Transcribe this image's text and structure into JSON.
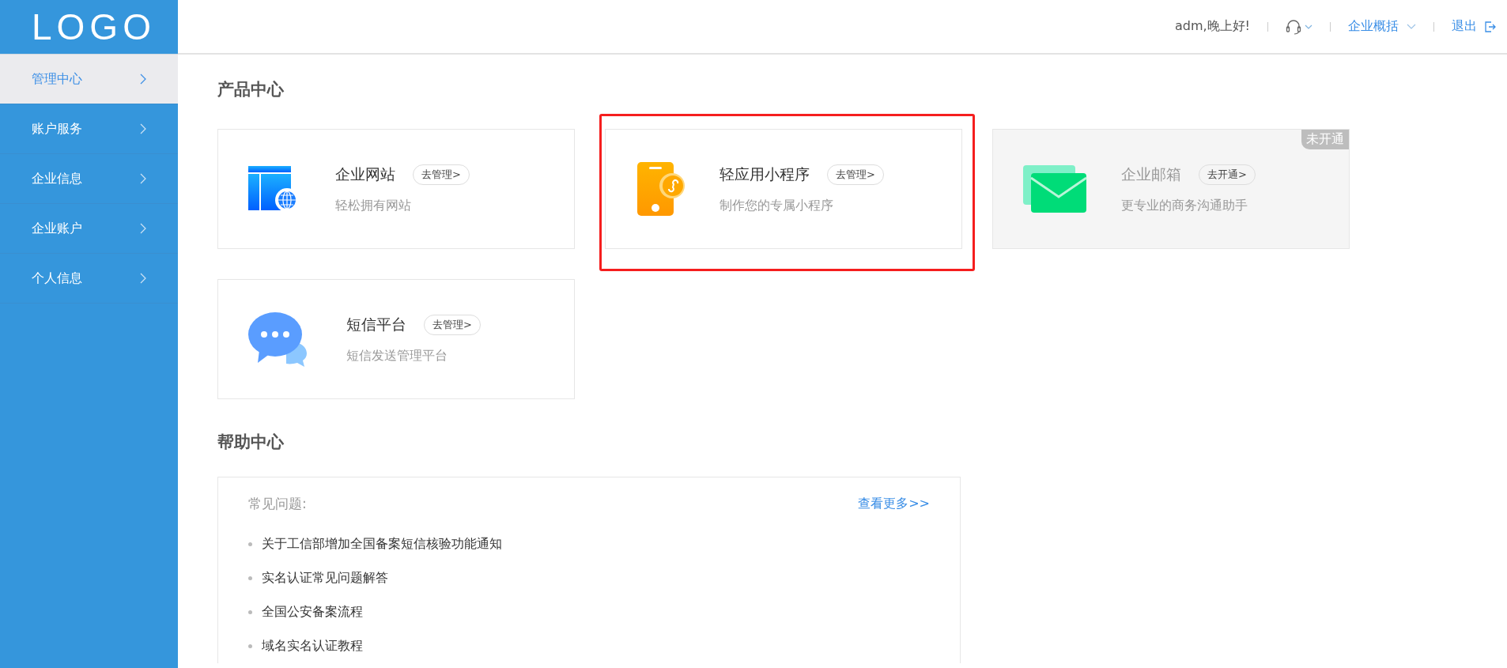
{
  "logo": "LOGO",
  "header": {
    "greeting": "adm,晚上好!",
    "menu_label": "企业概括",
    "logout": "退出"
  },
  "sidebar": {
    "items": [
      {
        "label": "管理中心",
        "selected": true
      },
      {
        "label": "账户服务",
        "selected": false
      },
      {
        "label": "企业信息",
        "selected": false
      },
      {
        "label": "企业账户",
        "selected": false
      },
      {
        "label": "个人信息",
        "selected": false
      }
    ]
  },
  "products": {
    "title": "产品中心",
    "cards": [
      {
        "kind": "website",
        "name": "企业网站",
        "action": "去管理>",
        "desc": "轻松拥有网站",
        "disabled": false,
        "highlighted": false
      },
      {
        "kind": "miniapp",
        "name": "轻应用小程序",
        "action": "去管理>",
        "desc": "制作您的专属小程序",
        "disabled": false,
        "highlighted": true
      },
      {
        "kind": "mail",
        "name": "企业邮箱",
        "action": "去开通>",
        "desc": "更专业的商务沟通助手",
        "disabled": true,
        "highlighted": false,
        "badge": "未开通"
      },
      {
        "kind": "sms",
        "name": "短信平台",
        "action": "去管理>",
        "desc": "短信发送管理平台",
        "disabled": false,
        "highlighted": false
      }
    ]
  },
  "help": {
    "title": "帮助中心",
    "faq_label": "常见问题:",
    "more_link": "查看更多>>",
    "items": [
      "关于工信部增加全国备案短信核验功能通知",
      "实名认证常见问题解答",
      "全国公安备案流程",
      "域名实名认证教程"
    ]
  }
}
